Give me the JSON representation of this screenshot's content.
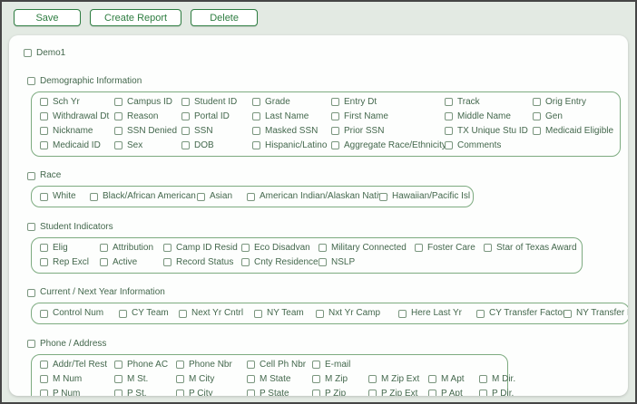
{
  "colors": {
    "accent_green": "#2e7d41",
    "label_green": "#44684d",
    "groupbox_border": "#7dab80",
    "page_bg": "#e3eae3",
    "panel_bg": "#fdfefd"
  },
  "toolbar": {
    "buttons": [
      {
        "id": "save",
        "label": "Save"
      },
      {
        "id": "create-report",
        "label": "Create Report"
      },
      {
        "id": "delete",
        "label": "Delete"
      }
    ]
  },
  "root_checkbox": {
    "label": "Demo1",
    "checked": false
  },
  "sections": [
    {
      "id": "demographic",
      "label": "Demographic Information",
      "checked": false,
      "rows": [
        [
          "Sch Yr",
          "Campus ID",
          "Student ID",
          "Grade",
          "Entry Dt",
          "Track",
          "Orig Entry"
        ],
        [
          "Withdrawal Dt",
          "Reason",
          "Portal ID",
          "Last Name",
          "First Name",
          "Middle Name",
          "Gen"
        ],
        [
          "Nickname",
          "SSN Denied",
          "SSN",
          "Masked SSN",
          "Prior SSN",
          "TX Unique Stu ID",
          "Medicaid Eligible"
        ],
        [
          "Medicaid ID",
          "Sex",
          "DOB",
          "Hispanic/Latino",
          "Aggregate Race/Ethnicity",
          "Comments"
        ]
      ]
    },
    {
      "id": "race",
      "label": "Race",
      "checked": false,
      "rows": [
        [
          "White",
          "Black/African American",
          "Asian",
          "American Indian/Alaskan Native",
          "Hawaiian/Pacific Isl"
        ]
      ]
    },
    {
      "id": "indicators",
      "label": "Student Indicators",
      "checked": false,
      "rows": [
        [
          "Elig",
          "Attribution",
          "Camp ID Resid",
          "Eco Disadvan",
          "Military Connected",
          "Foster Care",
          "Star of Texas Award"
        ],
        [
          "Rep Excl",
          "Active",
          "Record Status",
          "Cnty Residence",
          "NSLP"
        ]
      ]
    },
    {
      "id": "nextyear",
      "label": "Current / Next Year Information",
      "checked": false,
      "rows": [
        [
          "Control Num",
          "CY Team",
          "Next Yr Cntrl",
          "NY Team",
          "Nxt Yr Camp",
          "Here Last Yr",
          "CY Transfer Factor",
          "NY Transfer Factor"
        ]
      ]
    },
    {
      "id": "phone",
      "label": "Phone / Address",
      "checked": false,
      "rows": [
        [
          "Addr/Tel Rest",
          "Phone AC",
          "Phone Nbr",
          "Cell Ph Nbr",
          "E-mail"
        ],
        [
          "M Num",
          "M St.",
          "M City",
          "M State",
          "M Zip",
          "M Zip Ext",
          "M Apt",
          "M Dir."
        ],
        [
          "P Num",
          "P St.",
          "P City",
          "P State",
          "P Zip",
          "P Zip Ext",
          "P Apt",
          "P Dir."
        ]
      ]
    }
  ]
}
